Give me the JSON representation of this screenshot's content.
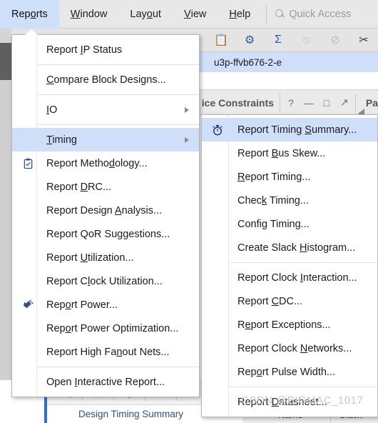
{
  "menubar": {
    "items": [
      {
        "label": "Reports",
        "mnemonic_index": 3,
        "active": true
      },
      {
        "label": "Window",
        "mnemonic_index": 0,
        "active": false
      },
      {
        "label": "Layout",
        "mnemonic_index": 3,
        "active": false
      },
      {
        "label": "View",
        "mnemonic_index": 0,
        "active": false
      },
      {
        "label": "Help",
        "mnemonic_index": 0,
        "active": false
      }
    ],
    "quick_access": "Quick Access"
  },
  "toolbar": {
    "icons": [
      {
        "name": "report-clipboard-icon",
        "glyph": "📋",
        "state": "normal"
      },
      {
        "name": "settings-gear-icon",
        "glyph": "⚙",
        "state": "normal"
      },
      {
        "name": "sigma-icon",
        "glyph": "Σ",
        "state": "normal"
      },
      {
        "name": "report-disabled-icon",
        "glyph": "⦸",
        "state": "disabled"
      },
      {
        "name": "clip-disabled-icon",
        "glyph": "⊘",
        "state": "disabled"
      },
      {
        "name": "cut-icon",
        "glyph": "✂",
        "state": "dark"
      }
    ]
  },
  "selected_row": {
    "text": "u3p-ffvb676-2-e"
  },
  "panels": {
    "device_constraints_title": "ice Constraints",
    "help_btn": "?",
    "minimize_btn": "—",
    "maximize_btn": "□",
    "float_btn": "↗",
    "right_panel_title": "Pa"
  },
  "bottom": {
    "search_icon": "search-icon",
    "collapse_icon": "collapse-all-icon",
    "expand_icon": "expand-all-icon",
    "info_icon": "info-icon",
    "summary_label": "Design Timing Summary",
    "columns": [
      "Name",
      "Slack"
    ]
  },
  "reports_menu": {
    "items": [
      {
        "label": "Report IP Status",
        "mnemonic": "I",
        "icon": null,
        "submenu": false,
        "selected": false,
        "separator_after": true
      },
      {
        "label": "Compare Block Designs...",
        "mnemonic": "C",
        "icon": null,
        "submenu": false,
        "selected": false,
        "separator_after": true
      },
      {
        "label": "IO",
        "mnemonic": "I",
        "icon": null,
        "submenu": true,
        "selected": false,
        "separator_after": true
      },
      {
        "label": "Timing",
        "mnemonic": "T",
        "icon": null,
        "submenu": true,
        "selected": true,
        "separator_after": false
      },
      {
        "label": "Report Methodology...",
        "mnemonic": "d",
        "icon": "clipboard-check-icon",
        "submenu": false,
        "selected": false,
        "separator_after": false
      },
      {
        "label": "Report DRC...",
        "mnemonic": "D",
        "icon": null,
        "submenu": false,
        "selected": false,
        "separator_after": false
      },
      {
        "label": "Report Design Analysis...",
        "mnemonic": "A",
        "icon": null,
        "submenu": false,
        "selected": false,
        "separator_after": false
      },
      {
        "label": "Report QoR Suggestions...",
        "mnemonic": "",
        "icon": null,
        "submenu": false,
        "selected": false,
        "separator_after": false
      },
      {
        "label": "Report Utilization...",
        "mnemonic": "U",
        "icon": null,
        "submenu": false,
        "selected": false,
        "separator_after": false
      },
      {
        "label": "Report Clock Utilization...",
        "mnemonic": "l",
        "icon": null,
        "submenu": false,
        "selected": false,
        "separator_after": false
      },
      {
        "label": "Report Power...",
        "mnemonic": "o",
        "icon": "power-plug-icon",
        "submenu": false,
        "selected": false,
        "separator_after": false
      },
      {
        "label": "Report Power Optimization...",
        "mnemonic": "o",
        "icon": null,
        "submenu": false,
        "selected": false,
        "separator_after": false
      },
      {
        "label": "Report High Fanout Nets...",
        "mnemonic": "n",
        "icon": null,
        "submenu": false,
        "selected": false,
        "separator_after": true
      },
      {
        "label": "Open Interactive Report...",
        "mnemonic": "I",
        "icon": null,
        "submenu": false,
        "selected": false,
        "separator_after": false
      }
    ]
  },
  "timing_menu": {
    "items": [
      {
        "label": "Report Timing Summary...",
        "mnemonic": "S",
        "icon": "timer-icon",
        "selected": true,
        "separator_after": false
      },
      {
        "label": "Report Bus Skew...",
        "mnemonic": "B",
        "icon": null,
        "selected": false,
        "separator_after": false
      },
      {
        "label": "Report Timing...",
        "mnemonic": "R",
        "icon": null,
        "selected": false,
        "separator_after": false
      },
      {
        "label": "Check Timing...",
        "mnemonic": "k",
        "icon": null,
        "selected": false,
        "separator_after": false
      },
      {
        "label": "Config Timing...",
        "mnemonic": "g",
        "icon": null,
        "selected": false,
        "separator_after": false
      },
      {
        "label": "Create Slack Histogram...",
        "mnemonic": "H",
        "icon": null,
        "selected": false,
        "separator_after": true
      },
      {
        "label": "Report Clock Interaction...",
        "mnemonic": "I",
        "icon": null,
        "selected": false,
        "separator_after": false
      },
      {
        "label": "Report CDC...",
        "mnemonic": "C",
        "icon": null,
        "selected": false,
        "separator_after": false
      },
      {
        "label": "Report Exceptions...",
        "mnemonic": "e",
        "icon": null,
        "selected": false,
        "separator_after": false
      },
      {
        "label": "Report Clock Networks...",
        "mnemonic": "N",
        "icon": null,
        "selected": false,
        "separator_after": false
      },
      {
        "label": "Report Pulse Width...",
        "mnemonic": "o",
        "icon": null,
        "selected": false,
        "separator_after": true
      },
      {
        "label": "Report Datasheet...",
        "mnemonic": "D",
        "icon": null,
        "selected": false,
        "separator_after": false
      }
    ]
  },
  "watermark": {
    "text": "CSDN @BIGMAC_1017"
  }
}
